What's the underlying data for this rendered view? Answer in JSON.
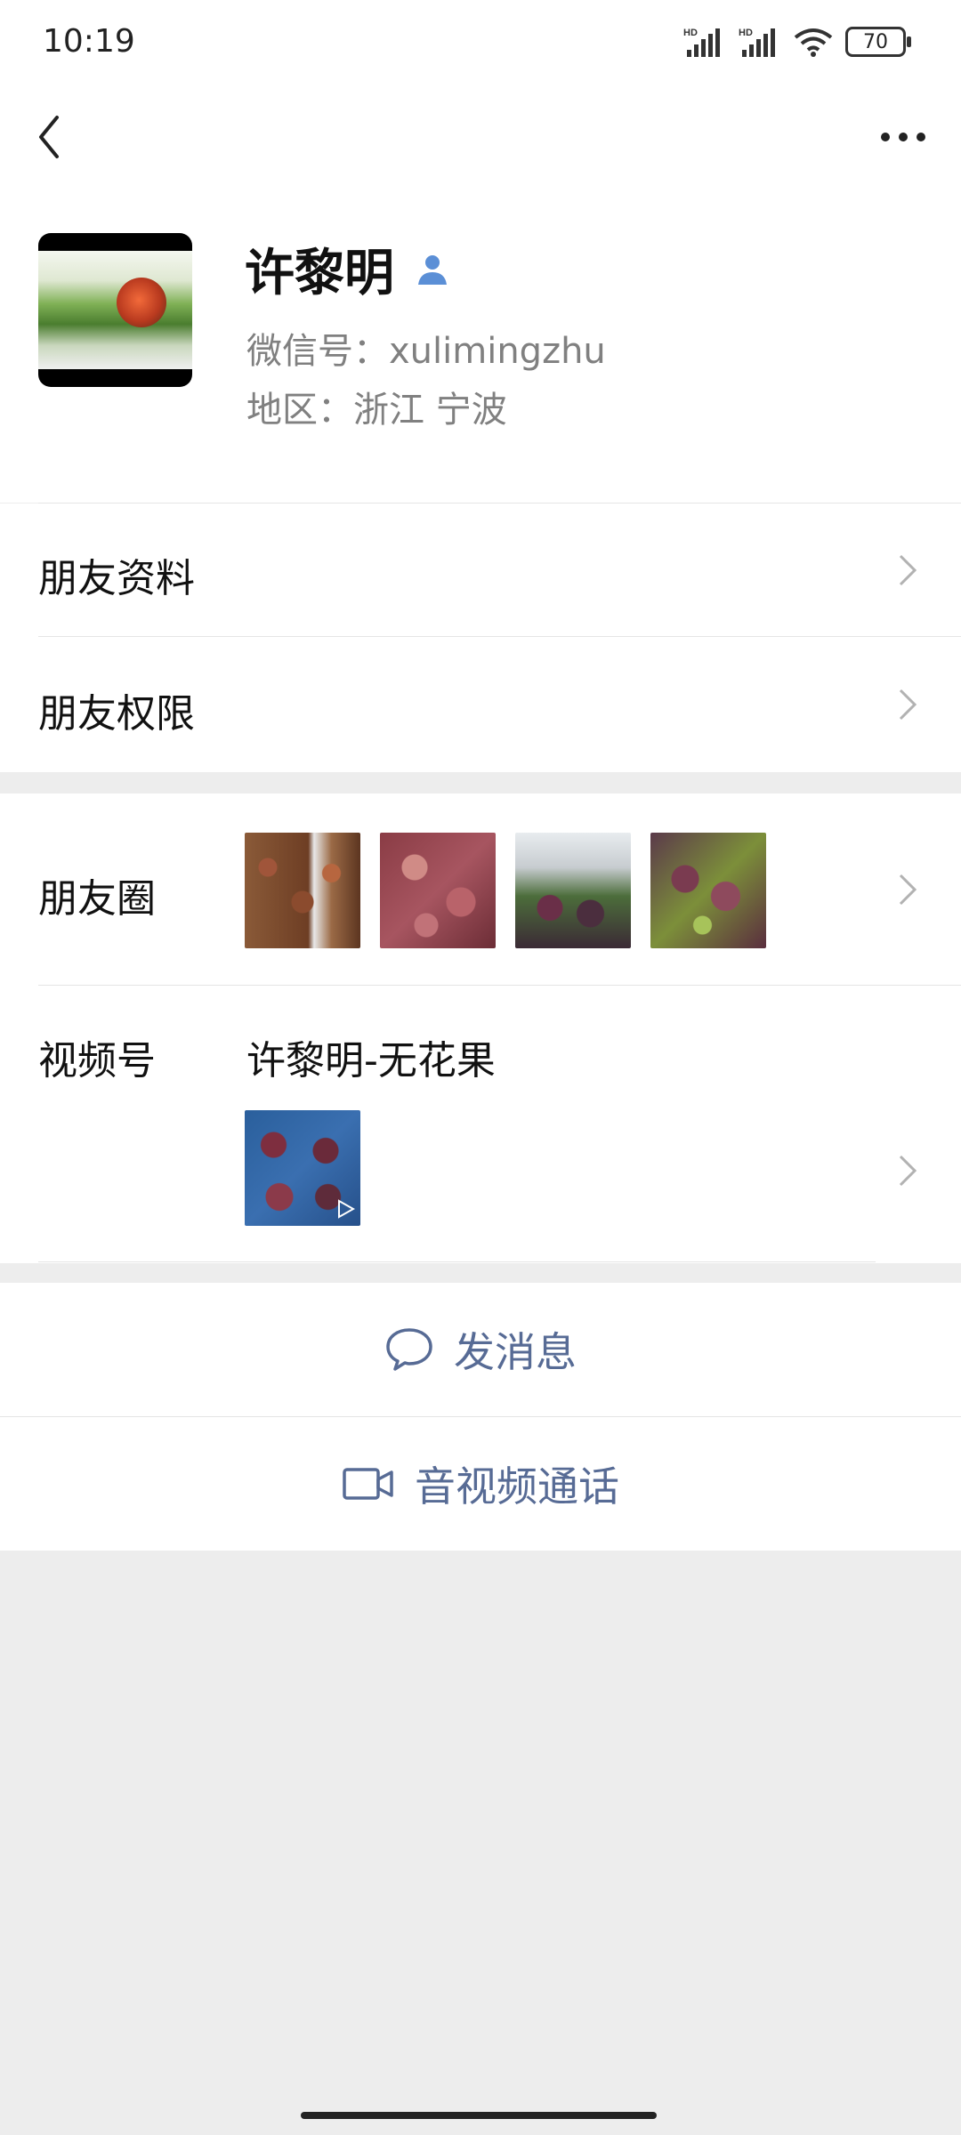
{
  "status_bar": {
    "time": "10:19",
    "battery": "70",
    "net1": "HD",
    "net2": "HD"
  },
  "profile": {
    "name": "许黎明",
    "wechat_id": "微信号：xulimingzhu",
    "region": "地区：浙江  宁波"
  },
  "menu": {
    "friend_info": "朋友资料",
    "friend_permissions": "朋友权限",
    "moments": "朋友圈",
    "channels": "视频号",
    "channels_name": "许黎明-无花果"
  },
  "actions": {
    "send_message": "发消息",
    "video_call": "音视频通话"
  },
  "colors": {
    "link": "#576b95",
    "background": "#ededed",
    "contact_icon": "#5b8fd6"
  }
}
